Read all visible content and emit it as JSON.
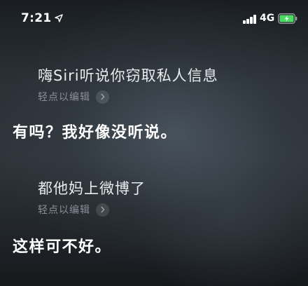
{
  "status_bar": {
    "time": "7:21",
    "network": "4G",
    "icons": {
      "location": "location-arrow-icon",
      "signal": "cellular-signal-icon",
      "battery": "battery-charging-icon"
    },
    "battery_color": "#4cd964"
  },
  "conversation": [
    {
      "utterance": "嗨Siri听说你窃取私人信息",
      "edit_hint": "轻点以编辑",
      "reply": "有吗？我好像没听说。"
    },
    {
      "utterance": "都他妈上微博了",
      "edit_hint": "轻点以编辑",
      "reply": "这样可不好。"
    }
  ]
}
